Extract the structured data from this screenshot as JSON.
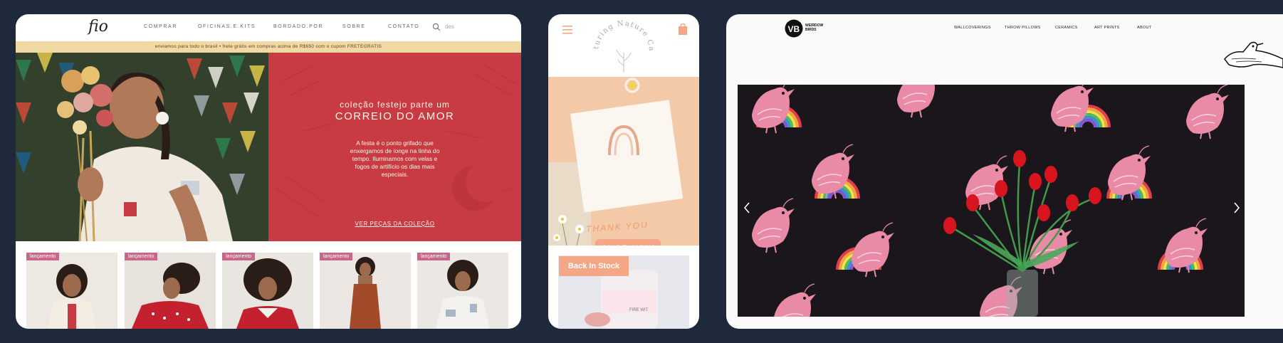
{
  "card1": {
    "logo": "fio",
    "nav": [
      "COMPRAR",
      "OFICINAS.E.KITS",
      "BORDADO.POR",
      "SOBRE",
      "CONTATO"
    ],
    "search_value": "des",
    "banner": "enviamos para todo o brasil • frete grátis em compras acima de R$650 com o cupom FRETEGRATIS",
    "hero": {
      "subtitle": "coleção festejo parte um",
      "title": "CORREIO DO AMOR",
      "text": "A festa é o ponto grifado que enxergamos de longe na linha do tempo. Iluminamos com velas e fogos de artifício os dias mais especiais.",
      "link": "VER PEÇAS DA COLEÇÃO"
    },
    "products": [
      {
        "badge": "lançamento"
      },
      {
        "badge": "lançamento"
      },
      {
        "badge": "lançamento"
      },
      {
        "badge": "lançamento"
      },
      {
        "badge": "lançamento"
      }
    ]
  },
  "card2": {
    "brand": "Nurturing Nature Cards",
    "card_text": "THANK YOU",
    "shop_button": "SHOP NOW",
    "badge": "Back In Stock",
    "jar_text": "FIRE WIT"
  },
  "card3": {
    "brand_line1": "WEIRDOW",
    "brand_line2": "BIRDS",
    "nav": [
      "WALLCOVERINGS",
      "THROW PILLOWS",
      "CERAMICS",
      "ART PRINTS",
      "ABOUT"
    ]
  },
  "colors": {
    "page_bg": "#1e2a3c",
    "fio_red": "#c83b43",
    "fio_banner": "#f1d9a4",
    "badge_pink": "#c76789",
    "peach": "#f4a787",
    "wallpaper_bg": "#1a161b",
    "bird_pink": "#e98aa6"
  },
  "icons": [
    "search-icon",
    "hamburger-menu-icon",
    "shopping-bag-icon",
    "bird-illustration-icon",
    "chevron-left-icon",
    "chevron-right-icon"
  ]
}
